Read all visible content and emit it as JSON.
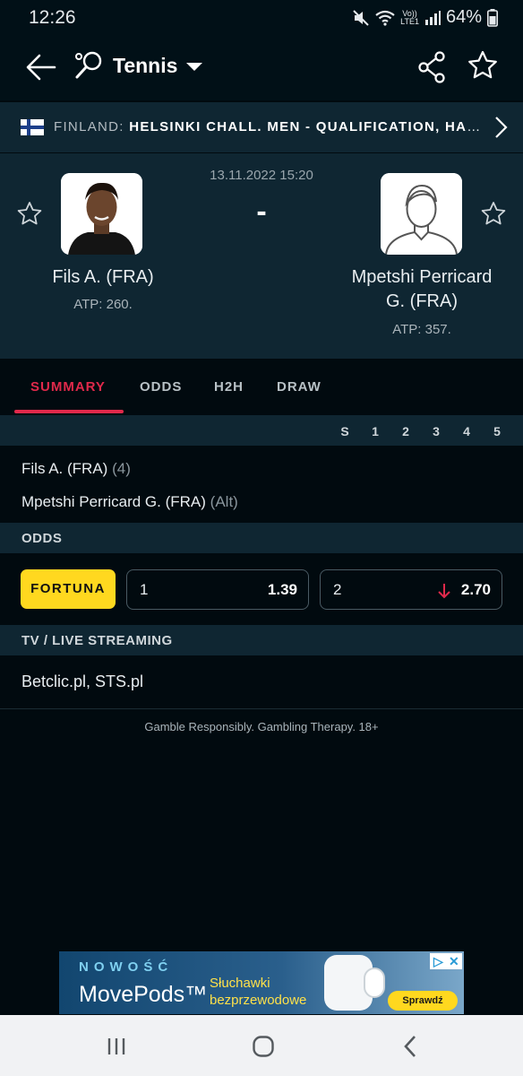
{
  "status_bar": {
    "time": "12:26",
    "network": "LTE1",
    "volte": "Vo))",
    "battery": "64%"
  },
  "header": {
    "sport": "Tennis"
  },
  "league": {
    "country": "FINLAND:",
    "name": "HELSINKI CHALL. MEN - QUALIFICATION, HARD (INDOOR)"
  },
  "match": {
    "datetime": "13.11.2022 15:20",
    "score": "-",
    "home": {
      "name": "Fils A. (FRA)",
      "rank": "ATP: 260."
    },
    "away": {
      "name_line1": "Mpetshi Perricard",
      "name_line2": "G. (FRA)",
      "rank": "ATP: 357."
    }
  },
  "tabs": [
    {
      "label": "SUMMARY",
      "active": true
    },
    {
      "label": "ODDS"
    },
    {
      "label": "H2H"
    },
    {
      "label": "DRAW"
    }
  ],
  "sets_header": [
    "S",
    "1",
    "2",
    "3",
    "4",
    "5"
  ],
  "players": [
    {
      "name": "Fils A. (FRA)",
      "tag": "(4)"
    },
    {
      "name": "Mpetshi Perricard G. (FRA)",
      "tag": "(Alt)"
    }
  ],
  "odds": {
    "section_title": "ODDS",
    "bookmaker": "FORTUNA",
    "bookmaker_color": "#ffd81f",
    "items": [
      {
        "label": "1",
        "value": "1.39"
      },
      {
        "label": "2",
        "value": "2.70",
        "trend": "down",
        "trend_color": "#e1294b"
      }
    ]
  },
  "tv": {
    "section_title": "TV / LIVE STREAMING",
    "channels": "Betclic.pl, STS.pl"
  },
  "footer_note": "Gamble Responsibly. Gambling Therapy. 18+",
  "ad": {
    "kicker": "NOWOŚĆ",
    "product": "MovePods™",
    "desc_line1": "Słuchawki",
    "desc_line2": "bezprzewodowe",
    "cta": "Sprawdź"
  },
  "colors": {
    "accent": "#e1294b",
    "panel": "#0f2632",
    "background": "#010a0f"
  }
}
